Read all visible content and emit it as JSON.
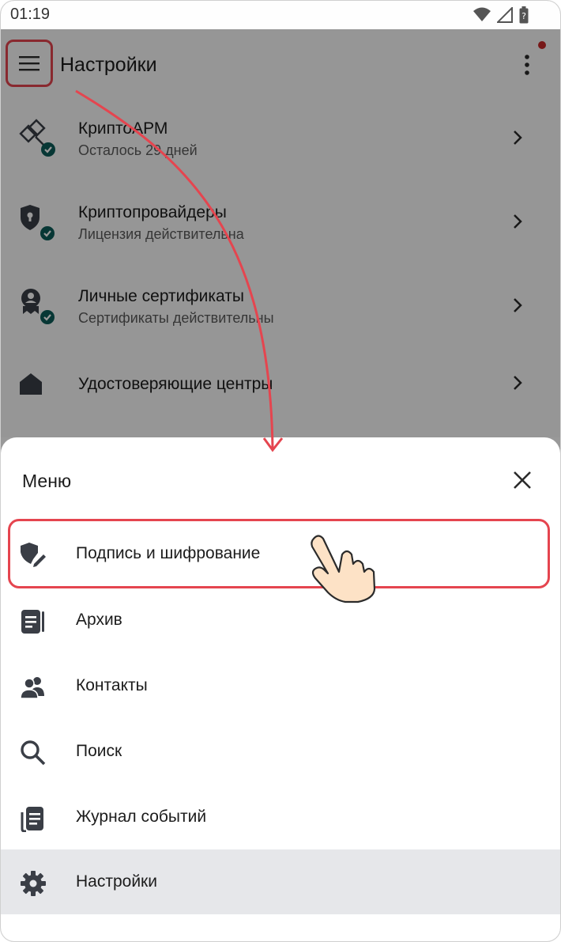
{
  "status_bar": {
    "time": "01:19",
    "icons": [
      "wifi-icon",
      "signal-icon",
      "battery-icon"
    ]
  },
  "app_bar": {
    "title": "Настройки",
    "menu_icon": "hamburger-icon",
    "more_icon": "more-vert-icon"
  },
  "settings_items": [
    {
      "title": "КриптоАРМ",
      "subtitle": "Осталось 29 дней",
      "icon": "cryptoarm-key-icon",
      "verified": true
    },
    {
      "title": "Криптопровайдеры",
      "subtitle": "Лицензия действительна",
      "icon": "shield-lock-icon",
      "verified": true
    },
    {
      "title": "Личные сертификаты",
      "subtitle": "Сертификаты действительны",
      "icon": "certificate-badge-icon",
      "verified": true
    },
    {
      "title": "Удостоверяющие центры",
      "subtitle": "",
      "icon": "home-icon",
      "verified": false
    }
  ],
  "menu_sheet": {
    "title": "Меню",
    "close_icon": "close-icon",
    "items": [
      {
        "label": "Подпись и шифрование",
        "icon": "shield-pen-icon",
        "highlighted": true
      },
      {
        "label": "Архив",
        "icon": "archive-icon"
      },
      {
        "label": "Контакты",
        "icon": "contacts-icon"
      },
      {
        "label": "Поиск",
        "icon": "search-icon"
      },
      {
        "label": "Журнал событий",
        "icon": "event-log-icon"
      },
      {
        "label": "Настройки",
        "icon": "gear-icon",
        "selected": true
      }
    ]
  },
  "colors": {
    "accent_highlight": "#e5454f",
    "verified_badge": "#0d5c59",
    "icon_dark": "#3a3e46",
    "selected_bg": "#e6e7ea"
  }
}
